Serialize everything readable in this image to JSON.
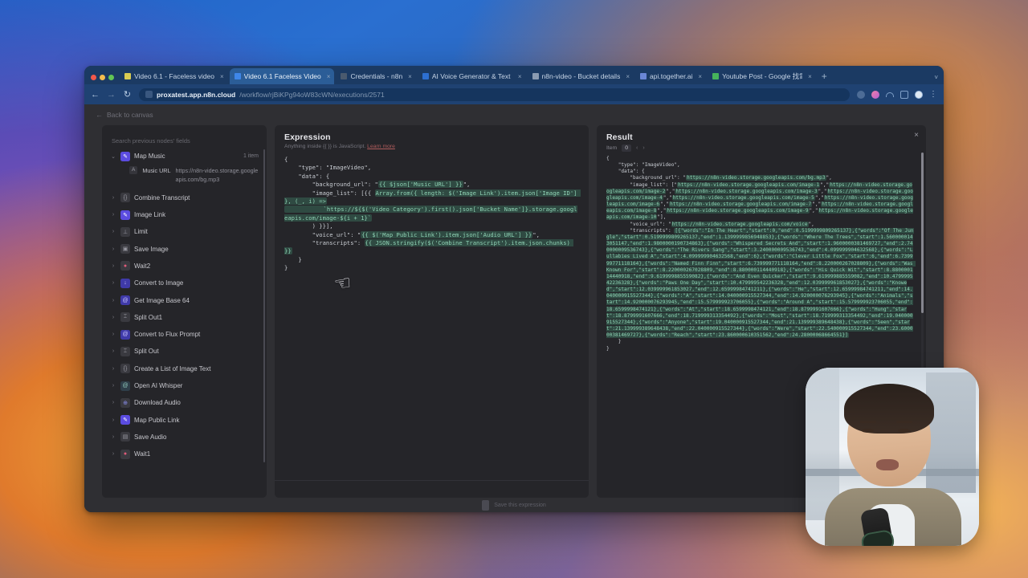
{
  "browser": {
    "traffic_lights": [
      "close",
      "minimize",
      "maximize"
    ],
    "tabs": [
      {
        "label": "Video 6.1 - Faceless video -",
        "favicon_color": "#d9cc52",
        "active": false,
        "close": "×"
      },
      {
        "label": "Video 6.1 Faceless Video",
        "favicon_color": "#3f87e8",
        "active": true,
        "close": "×"
      },
      {
        "label": "Credentials - n8n",
        "favicon_color": "#4a5a6e",
        "active": false,
        "close": "×"
      },
      {
        "label": "AI Voice Generator & Text to",
        "favicon_color": "#2d6fd0",
        "active": false,
        "close": "×"
      },
      {
        "label": "n8n-video - Bucket details",
        "favicon_color": "#8a9bb2",
        "active": false,
        "close": "×"
      },
      {
        "label": "api.together.ai",
        "favicon_color": "#6a86d6",
        "active": false,
        "close": "×"
      },
      {
        "label": "Youtube Post - Google 找電腦",
        "favicon_color": "#46b35b",
        "active": false,
        "close": "×"
      }
    ],
    "new_tab_label": "+",
    "tab_list_chevron": "˅",
    "nav": {
      "back": "←",
      "forward": "→",
      "reload": "↻"
    },
    "omnibox": {
      "host": "proxatest.app.n8n.cloud",
      "path": "/workflow/rjBiKPg94oW83cWN/executions/2571",
      "site_icon": "tune-icon"
    },
    "toolbar_icons": [
      "star-icon",
      "extension-pink-icon",
      "extension-arc-icon",
      "extension-box-icon",
      "profile-avatar",
      "kebab-menu-icon"
    ]
  },
  "n8n": {
    "back_link": "Back to canvas",
    "input_panel": {
      "search_placeholder": "Search previous nodes' fields",
      "nodes": [
        {
          "label": "Map Music",
          "icon": "pen-icon",
          "icon_class": "pen",
          "count": "1 item",
          "expanded": true,
          "chevron": "⌄"
        },
        {
          "label": "Combine Transcript",
          "icon": "code-icon",
          "icon_class": "code",
          "glyph": "{}",
          "expanded": false,
          "chevron": "›"
        },
        {
          "label": "Image Link",
          "icon": "pen-icon",
          "icon_class": "pen",
          "expanded": false,
          "chevron": "›"
        },
        {
          "label": "Limit",
          "icon": "limit-icon",
          "icon_class": "limit",
          "glyph": "⊥",
          "expanded": false,
          "chevron": "›"
        },
        {
          "label": "Save Image",
          "icon": "save-icon",
          "icon_class": "save",
          "glyph": "▣",
          "expanded": false,
          "chevron": "›"
        },
        {
          "label": "Wait2",
          "icon": "wait-icon",
          "icon_class": "wait",
          "glyph": "●",
          "expanded": false,
          "chevron": "›"
        },
        {
          "label": "Convert to Image",
          "icon": "convert-icon",
          "icon_class": "convert",
          "glyph": "↓",
          "expanded": false,
          "chevron": "›"
        },
        {
          "label": "Get Image Base 64",
          "icon": "convert-icon",
          "icon_class": "convert",
          "glyph": "@",
          "expanded": false,
          "chevron": "›"
        },
        {
          "label": "Split Out1",
          "icon": "split-icon",
          "icon_class": "split",
          "glyph": "⌶",
          "expanded": false,
          "chevron": "›"
        },
        {
          "label": "Convert to Flux Prompt",
          "icon": "convert-icon",
          "icon_class": "convert",
          "glyph": "@",
          "expanded": false,
          "chevron": "›"
        },
        {
          "label": "Split Out",
          "icon": "split-icon",
          "icon_class": "split",
          "glyph": "⌶",
          "expanded": false,
          "chevron": "›"
        },
        {
          "label": "Create a List of Image Text",
          "icon": "code-icon",
          "icon_class": "code",
          "glyph": "{}",
          "expanded": false,
          "chevron": "›"
        },
        {
          "label": "Open AI Whisper",
          "icon": "openai-icon",
          "icon_class": "openai",
          "glyph": "@",
          "expanded": false,
          "chevron": "›"
        },
        {
          "label": "Download Audio",
          "icon": "download-icon",
          "icon_class": "dl",
          "glyph": "⊕",
          "expanded": false,
          "chevron": "›"
        },
        {
          "label": "Map Public Link",
          "icon": "pen-icon",
          "icon_class": "pen",
          "expanded": false,
          "chevron": "›"
        },
        {
          "label": "Save Audio",
          "icon": "save-icon",
          "icon_class": "save",
          "glyph": "▤",
          "expanded": false,
          "chevron": "›"
        },
        {
          "label": "Wait1",
          "icon": "wait-icon",
          "icon_class": "wait",
          "glyph": "●",
          "expanded": false,
          "chevron": "›"
        }
      ],
      "expanded_field": {
        "badge": "A",
        "key": "Music URL",
        "value": "https://n8n-video.storage.googleapis.com/bg.mp3"
      }
    },
    "expression_panel": {
      "title": "Expression",
      "subtitle_pre": "Anything inside ",
      "subtitle_code": "{{ }}",
      "subtitle_post": " is JavaScript. ",
      "subtitle_link": "Learn more",
      "code_lines": [
        {
          "t": "{",
          "h": false
        },
        {
          "t": "    \"type\": \"ImageVideo\",",
          "h": false
        },
        {
          "t": "    \"data\": {",
          "h": false
        },
        {
          "t": "        \"background_url\": \"",
          "h": false,
          "expr": "{{ $json['Music URL'] }}",
          "tail": "\","
        },
        {
          "t": "        \"image_list\": [{{ ",
          "h": false,
          "expr2": "Array.from({ length: $('Image Link').item.json['Image ID'] }, (_, i) =>",
          "tail2": ""
        },
        {
          "t": "           `https://${$('Video Category').first().json['Bucket Name']}.storage.googleapis.com/image-${i + 1}`",
          "h": true
        },
        {
          "t": "        ) }}],",
          "h": false
        },
        {
          "t": "        \"voice_url\": \"",
          "h": false,
          "expr": "{{ $('Map Public Link').item.json['Audio URL'] }}",
          "tail": "\","
        },
        {
          "t": "        \"transcripts\": ",
          "h": false,
          "expr": "{{ JSON.stringify($('Combine Transcript').item.json.chunks) }}",
          "tail": ""
        },
        {
          "t": "    }",
          "h": false
        },
        {
          "t": "}",
          "h": false
        }
      ],
      "cursor_icon": "hand-pointer-cursor"
    },
    "result_panel": {
      "title": "Result",
      "close_label": "×",
      "item_label": "Item",
      "item_value": "0",
      "prev_arrow": "‹",
      "next_arrow": "›",
      "json": {
        "type": "ImageVideo",
        "background_url": "https://n8n-video.storage.googleapis.com/bg.mp3",
        "image_list": [
          "https://n8n-video.storage.googleapis.com/image-1",
          "https://n8n-video.storage.googleapis.com/image-2",
          "https://n8n-video.storage.googleapis.com/image-3",
          "https://n8n-video.storage.googleapis.com/image-4",
          "https://n8n-video.storage.googleapis.com/image-5",
          "https://n8n-video.storage.googleapis.com/image-6",
          "https://n8n-video.storage.googleapis.com/image-7",
          "https://n8n-video.storage.googleapis.com/image-8",
          "https://n8n-video.storage.googleapis.com/image-9",
          "https://n8n-video.storage.googleapis.com/image-10"
        ],
        "voice_url": "https://n8n-video.storage.googleapis.com/voice",
        "transcripts": [
          {
            "words": "In The Heart",
            "start": 0,
            "end": 0.5199999809265137
          },
          {
            "words": "Of The Jungle",
            "start": 0.5199999809265137,
            "end": 1.1399999856948853
          },
          {
            "words": "Where The Trees",
            "start": 1.5600000143051147,
            "end": 1.9800000190734863
          },
          {
            "words": "Whispered Secrets And",
            "start": 1.9600000381469727,
            "end": 2.740000009536743
          },
          {
            "words": "The Rivers Sang",
            "start": 3.240000009536743,
            "end": 4.099999904632568
          },
          {
            "words": "Lullabies Lived A",
            "start": 4.099999904632568,
            "end": 6
          },
          {
            "words": "Clever Little Fox",
            "start": 6,
            "end": 6.739999771118164
          },
          {
            "words": "Named Finn Finn",
            "start": 6.739999771118164,
            "end": 8.220000267028809
          },
          {
            "words": "Was Known For",
            "start": 8.220000267028809,
            "end": 8.880000114440918
          },
          {
            "words": "His Quick Wit",
            "start": 8.880000114440918,
            "end": 9.619999885559082
          },
          {
            "words": "And Even Quicker",
            "start": 9.619999885559082,
            "end": 10.479999542236328
          },
          {
            "words": "Paws One Day",
            "start": 10.479999542236328,
            "end": 12.039999961853027
          },
          {
            "words": "Knowed",
            "start": 12.039999961853027,
            "end": 12.65999984741211
          },
          {
            "words": "He",
            "start": 12.65999984741211,
            "end": 14.040000915527344
          },
          {
            "words": "A",
            "start": 14.040000915527344,
            "end": 14.920000076293945
          },
          {
            "words": "Animals",
            "start": 14.920000076293945,
            "end": 15.579999923706055
          },
          {
            "words": "Around A",
            "start": 15.579999923706055,
            "end": 18.6599998474121
          },
          {
            "words": "At",
            "start": 18.6599998474121,
            "end": 18.8799991607666
          },
          {
            "words": "Hung",
            "start": 18.8799991607666,
            "end": 18.719999313354492
          },
          {
            "words": "Most",
            "start": 18.719999313354492,
            "end": 19.040000915527344
          },
          {
            "words": "Anyone",
            "start": 19.040000915527344,
            "end": 21.139999389648438
          },
          {
            "words": "Seen",
            "start": 21.139999389648438,
            "end": 22.040000915527344
          },
          {
            "words": "Were",
            "start": 22.540000915527344,
            "end": 23.600000381469727
          },
          {
            "words": "Reach",
            "start": 23.860000610351562,
            "end": 24.28000068664551
          }
        ]
      }
    },
    "footer": {
      "text": "Save this expression"
    }
  },
  "webcam": {
    "label": "presenter-video-overlay"
  }
}
